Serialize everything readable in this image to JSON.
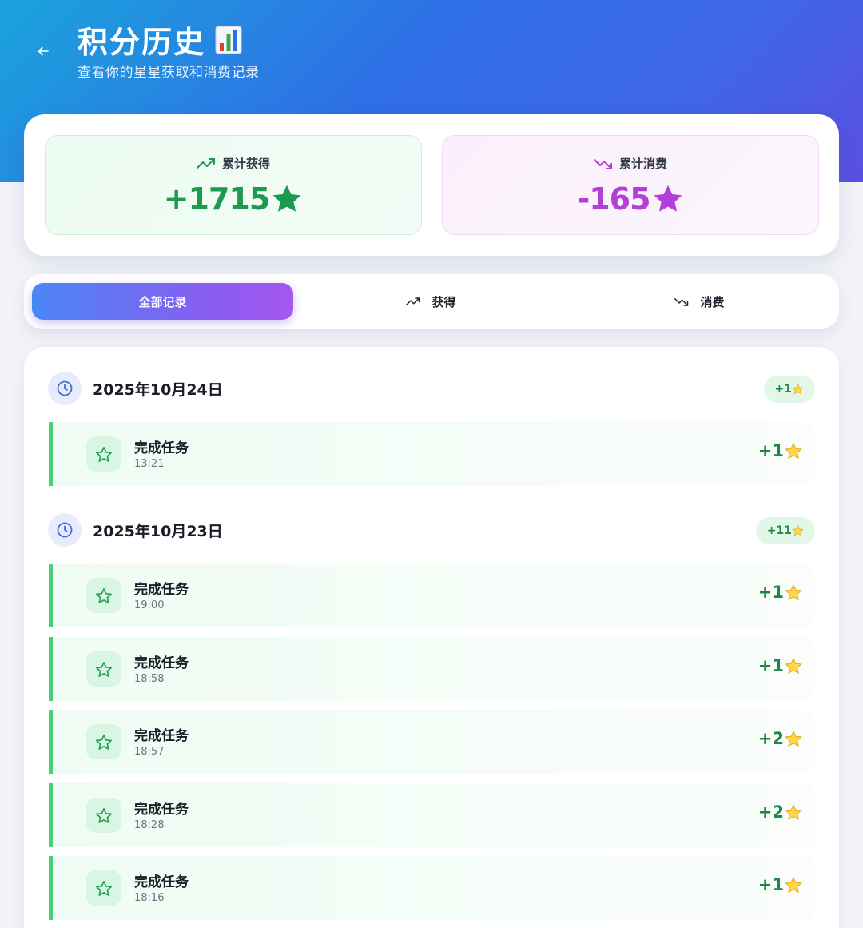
{
  "header": {
    "title": "积分历史",
    "subtitle": "查看你的星星获取和消费记录"
  },
  "summary": {
    "earned_label": "累计获得",
    "earned_value": "+1715",
    "spent_label": "累计消费",
    "spent_value": "-165"
  },
  "tabs": [
    {
      "label": "全部记录",
      "active": true
    },
    {
      "label": "获得",
      "active": false
    },
    {
      "label": "消费",
      "active": false
    }
  ],
  "days": [
    {
      "date": "2025年10月24日",
      "badge": "+1",
      "entries": [
        {
          "title": "完成任务",
          "time": "13:21",
          "amount": "+1"
        }
      ]
    },
    {
      "date": "2025年10月23日",
      "badge": "+11",
      "entries": [
        {
          "title": "完成任务",
          "time": "19:00",
          "amount": "+1"
        },
        {
          "title": "完成任务",
          "time": "18:58",
          "amount": "+1"
        },
        {
          "title": "完成任务",
          "time": "18:57",
          "amount": "+2"
        },
        {
          "title": "完成任务",
          "time": "18:28",
          "amount": "+2"
        },
        {
          "title": "完成任务",
          "time": "18:16",
          "amount": "+1"
        }
      ]
    }
  ],
  "colors": {
    "earn": "#1c9a4f",
    "spend": "#b23fd6",
    "accent_bar": "#4bd07a"
  }
}
